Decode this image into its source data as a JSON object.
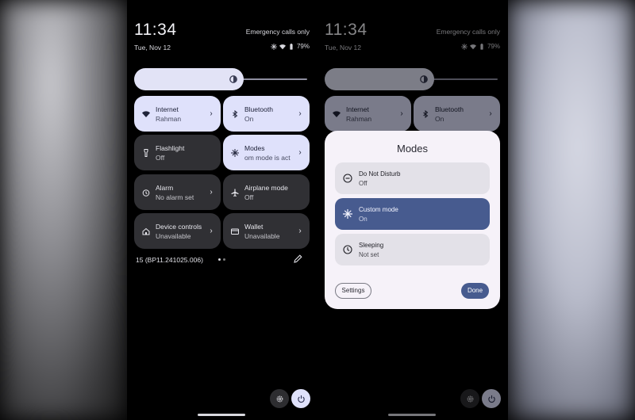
{
  "status_bar": {
    "time": "11:34",
    "date": "Tue, Nov 12",
    "emergency": "Emergency calls only",
    "battery": "79%"
  },
  "tiles": [
    {
      "title": "Internet",
      "subtitle": "Rahman",
      "icon": "wifi-icon",
      "active": true
    },
    {
      "title": "Bluetooth",
      "subtitle": "On",
      "icon": "bluetooth-icon",
      "active": true
    },
    {
      "title": "Flashlight",
      "subtitle": "Off",
      "icon": "flashlight-icon",
      "active": false
    },
    {
      "title": "Modes",
      "subtitle": "om mode is act",
      "icon": "modes-icon",
      "active": true
    },
    {
      "title": "Alarm",
      "subtitle": "No alarm set",
      "icon": "alarm-icon",
      "active": false
    },
    {
      "title": "Airplane mode",
      "subtitle": "Off",
      "icon": "airplane-icon",
      "active": false
    },
    {
      "title": "Device controls",
      "subtitle": "Unavailable",
      "icon": "home-icon",
      "active": false
    },
    {
      "title": "Wallet",
      "subtitle": "Unavailable",
      "icon": "wallet-icon",
      "active": false
    }
  ],
  "build_number": "15 (BP11.241025.006)",
  "modes_dialog": {
    "title": "Modes",
    "items": [
      {
        "name": "Do Not Disturb",
        "state": "Off",
        "icon": "dnd-icon",
        "active": false
      },
      {
        "name": "Custom mode",
        "state": "On",
        "icon": "snowflake-icon",
        "active": true
      },
      {
        "name": "Sleeping",
        "state": "Not set",
        "icon": "clock-icon",
        "active": false
      }
    ],
    "settings_label": "Settings",
    "done_label": "Done"
  },
  "colors": {
    "active_tile": "#dfe1fb",
    "inactive_tile": "#303034",
    "accent": "#475b8f"
  }
}
